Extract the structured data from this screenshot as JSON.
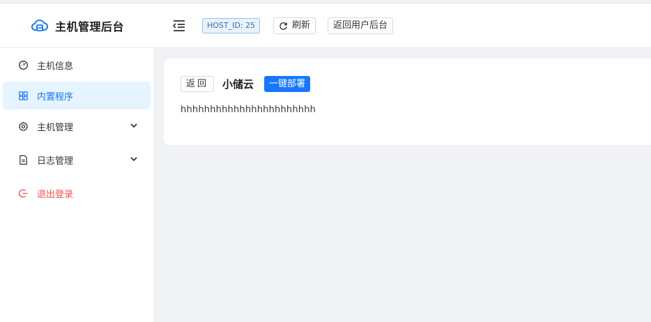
{
  "app": {
    "title": "主机管理后台",
    "logo_icon": "cloud-server-icon"
  },
  "header": {
    "toggle_icon": "menu-fold-icon",
    "host_tag": "HOST_ID: 25",
    "refresh_label": "刷新",
    "refresh_icon": "reload-icon",
    "back_user_label": "返回用户后台"
  },
  "sidebar": {
    "items": [
      {
        "label": "主机信息",
        "icon": "dashboard-icon",
        "active": false
      },
      {
        "label": "内置程序",
        "icon": "appstore-icon",
        "active": true
      },
      {
        "label": "主机管理",
        "icon": "setting-icon",
        "expandable": true
      },
      {
        "label": "日志管理",
        "icon": "file-text-icon",
        "expandable": true
      },
      {
        "label": "退出登录",
        "icon": "logout-icon",
        "danger": true
      }
    ]
  },
  "card": {
    "back_label": "返回",
    "title": "小储云",
    "deploy_label": "一键部署",
    "description": "hhhhhhhhhhhhhhhhhhhhhhh"
  },
  "colors": {
    "primary": "#1677ff",
    "active_bg": "#e6f4ff",
    "danger": "#ff4d4f",
    "page_bg": "#f0f2f5"
  }
}
